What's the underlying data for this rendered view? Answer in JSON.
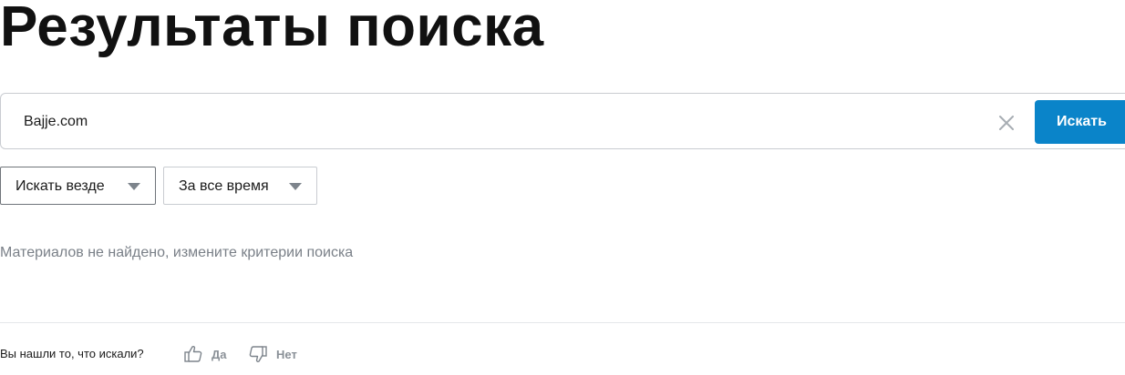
{
  "page": {
    "title": "Результаты поиска"
  },
  "search": {
    "value": "Bajje.com",
    "placeholder": "",
    "clear_icon": "close-icon",
    "submit_label": "Искать",
    "accent_color": "#0a84c9"
  },
  "filters": {
    "scope": {
      "selected": "Искать везде",
      "icon": "chevron-down-icon"
    },
    "period": {
      "selected": "За все время",
      "icon": "chevron-down-icon"
    }
  },
  "results": {
    "empty_message": "Материалов не найдено, измените критерии поиска"
  },
  "feedback": {
    "question": "Вы нашли то, что искали?",
    "yes": {
      "label": "Да",
      "icon": "thumbs-up-icon"
    },
    "no": {
      "label": "Нет",
      "icon": "thumbs-down-icon"
    }
  }
}
